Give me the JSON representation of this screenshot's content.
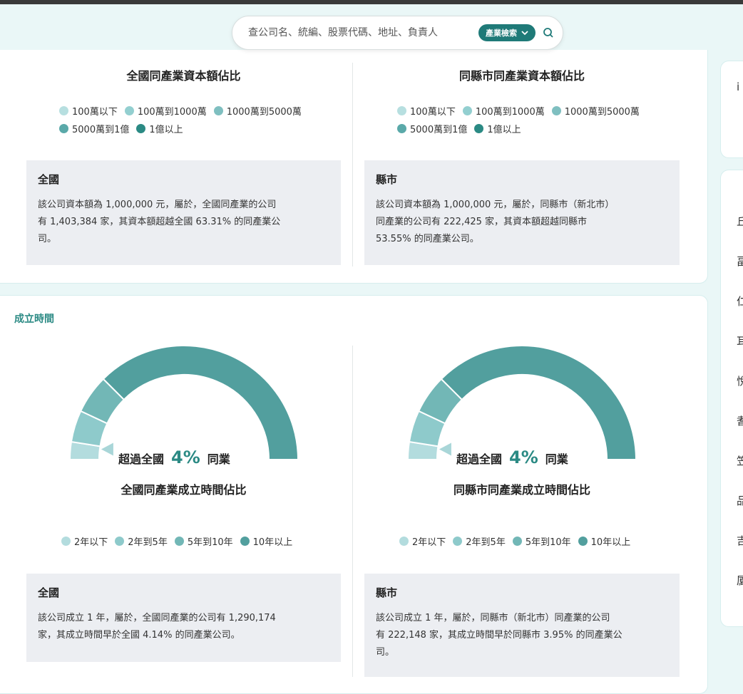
{
  "search": {
    "placeholder": "查公司名、統編、股票代碼、地址、負責人",
    "industry_button": "產業檢索"
  },
  "capital": {
    "legend": [
      "100萬以下",
      "100萬到1000萬",
      "1000萬到5000萬",
      "5000萬到1億",
      "1億以上"
    ],
    "national": {
      "title": "全國同產業資本額佔比",
      "box_head": "全國",
      "box_lines": [
        "該公司資本額為 1,000,000 元，屬於，全國同產業的公司",
        "有 1,403,384 家，其資本額超越全國 63.31% 的同產業公",
        "司。"
      ]
    },
    "county": {
      "title": "同縣市同產業資本額佔比",
      "box_head": "縣市",
      "box_lines": [
        "該公司資本額為 1,000,000 元，屬於，同縣市（新北市）",
        "同產業的公司有 222,425 家，其資本額超越同縣市",
        "53.55% 的同產業公司。"
      ]
    }
  },
  "founding": {
    "section_label": "成立時間",
    "legend": [
      "2年以下",
      "2年到5年",
      "5年到10年",
      "10年以上"
    ],
    "national": {
      "gauge_prefix": "超過全國",
      "gauge_pct": "4%",
      "gauge_suffix": "同業",
      "title": "全國同產業成立時間佔比",
      "box_head": "全國",
      "box_lines": [
        "該公司成立 1 年，屬於，全國同產業的公司有 1,290,174",
        "家，其成立時間早於全國 4.14% 的同產業公司。"
      ]
    },
    "county": {
      "gauge_prefix": "超過全國",
      "gauge_pct": "4%",
      "gauge_suffix": "同業",
      "title": "同縣市同產業成立時間佔比",
      "box_head": "縣市",
      "box_lines": [
        "該公司成立 1 年，屬於，同縣市（新北市）同產業的公司",
        "有 222,148 家，其成立時間早於同縣市 3.95% 的同產業公",
        "司。"
      ]
    }
  },
  "chart_data": [
    {
      "type": "gauge",
      "title": "全國同產業成立時間佔比",
      "categories": [
        "2年以下",
        "2年到5年",
        "5年到10年",
        "10年以上"
      ],
      "values": [
        5,
        9,
        11,
        75
      ],
      "marker_percent": 4
    },
    {
      "type": "gauge",
      "title": "同縣市同產業成立時間佔比",
      "categories": [
        "2年以下",
        "2年到5年",
        "5年到10年",
        "10年以上"
      ],
      "values": [
        5,
        9,
        11,
        75
      ],
      "marker_percent": 4
    }
  ],
  "colors": {
    "capital": [
      "#b7dfe0",
      "#93cfd0",
      "#7fbfc0",
      "#5aa9a9",
      "#2b8a84"
    ],
    "founding": [
      "#b3dcde",
      "#8ecacb",
      "#72b7b6",
      "#529f9e"
    ],
    "accent": "#2b8a84"
  },
  "side_letters": [
    "i",
    "丘",
    "畐",
    "仁",
    "耳",
    "悅",
    "耆",
    "笠",
    "品",
    "吉",
    "厦"
  ]
}
